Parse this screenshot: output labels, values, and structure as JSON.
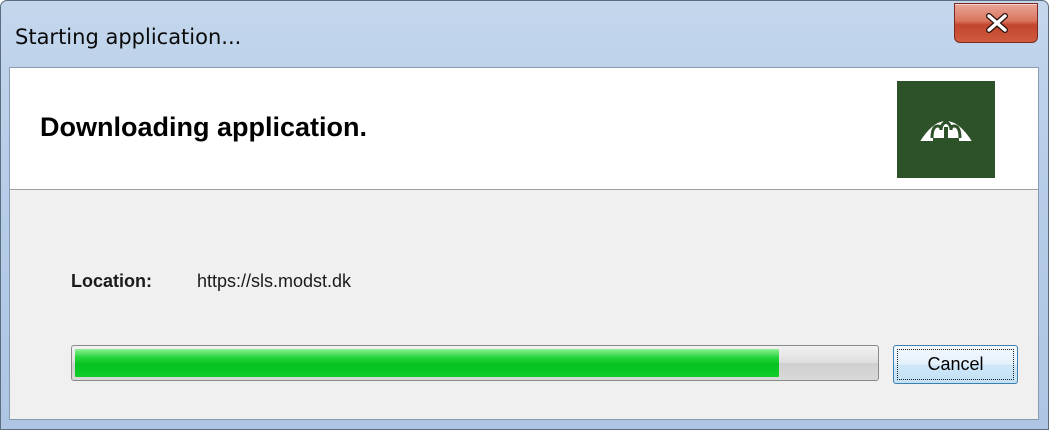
{
  "window": {
    "title": "Starting application..."
  },
  "header": {
    "heading": "Downloading application."
  },
  "details": {
    "location_label": "Location:",
    "location_value": "https://sls.modst.dk"
  },
  "progress": {
    "percent": 88
  },
  "buttons": {
    "cancel_label": "Cancel",
    "close_icon": "close-icon"
  },
  "logo": {
    "icon": "crown-icon",
    "background": "#2d5128"
  },
  "colors": {
    "progress_fill": "#06c21f",
    "close_button": "#c2452c"
  }
}
